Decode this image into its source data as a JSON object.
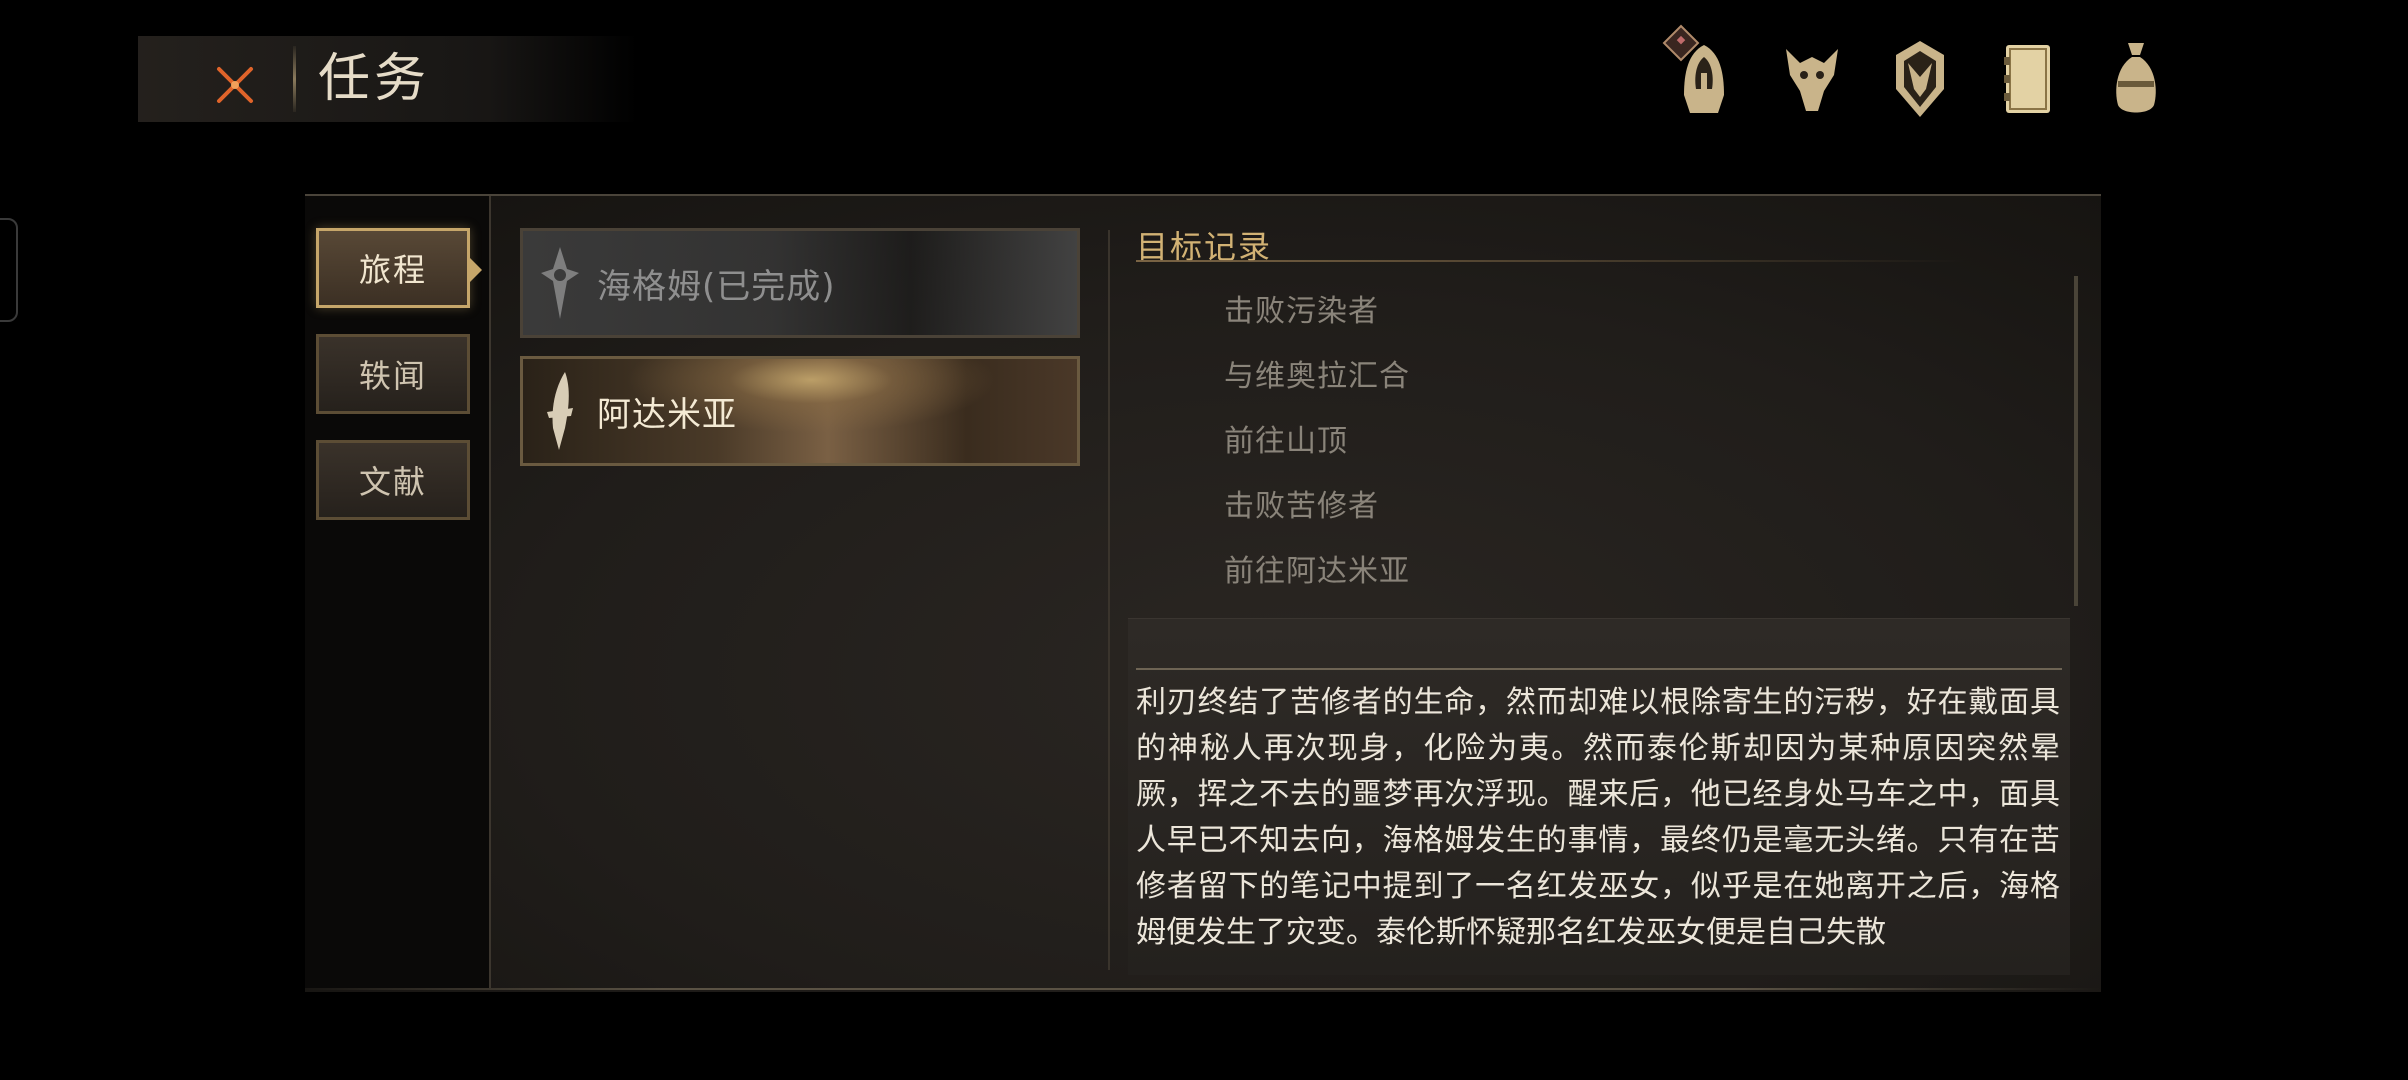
{
  "header": {
    "title": "任务",
    "close_icon": "crossed-swords-icon",
    "top_icons": [
      "hooded-knight-icon",
      "wolf-skull-icon",
      "demon-shield-icon",
      "journal-book-icon",
      "coin-pouch-icon"
    ]
  },
  "categories": [
    {
      "label": "旅程",
      "active": true
    },
    {
      "label": "轶闻",
      "active": false
    },
    {
      "label": "文献",
      "active": false
    }
  ],
  "quests": [
    {
      "label": "海格姆(已完成)",
      "status": "completed",
      "icon": "thorn-crest-icon"
    },
    {
      "label": "阿达米亚",
      "status": "current",
      "icon": "blade-crest-icon"
    }
  ],
  "objectives": {
    "title": "目标记录",
    "items": [
      "击败污染者",
      "与维奥拉汇合",
      "前往山顶",
      "击败苦修者",
      "前往阿达米亚"
    ]
  },
  "description": "利刃终结了苦修者的生命，然而却难以根除寄生的污秽，好在戴面具的神秘人再次现身，化险为夷。然而泰伦斯却因为某种原因突然晕厥，挥之不去的噩梦再次浮现。醒来后，他已经身处马车之中，面具人早已不知去向，海格姆发生的事情，最终仍是毫无头绪。只有在苦修者留下的笔记中提到了一名红发巫女，似乎是在她离开之后，海格姆便发生了灾变。泰伦斯怀疑那名红发巫女便是自己失散",
  "colors": {
    "accent_gold": "#c6a66a",
    "title_gold": "#d2b274",
    "close_orange": "#e0642a"
  }
}
